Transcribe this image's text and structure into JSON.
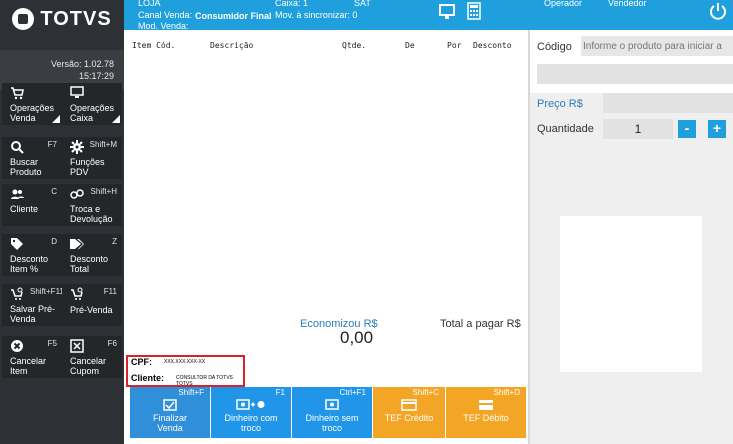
{
  "brand": {
    "name": "TOTVS"
  },
  "sidebar": {
    "version": "Versão: 1.02.78",
    "time": "15:17:29",
    "tiles": [
      {
        "label": "Operações Venda",
        "key": "",
        "icon": "cart-icon"
      },
      {
        "label": "Operações Caixa",
        "key": "",
        "icon": "monitor-icon"
      },
      {
        "label": "Buscar Produto",
        "key": "F7",
        "icon": "search-icon"
      },
      {
        "label": "Funções PDV",
        "key": "Shift+M",
        "icon": "gear-icon"
      },
      {
        "label": "Cliente",
        "key": "C",
        "icon": "users-icon"
      },
      {
        "label": "Troca e Devolução",
        "key": "Shift+H",
        "icon": "exchange-icon"
      },
      {
        "label": "Desconto Item %",
        "key": "D",
        "icon": "tag-icon"
      },
      {
        "label": "Desconto Total",
        "key": "Z",
        "icon": "tags-icon"
      },
      {
        "label": "Salvar Pré-Venda",
        "key": "Shift+F11",
        "icon": "cart-save-icon"
      },
      {
        "label": "Pré-Venda",
        "key": "F11",
        "icon": "cart-clock-icon"
      },
      {
        "label": "Cancelar Item",
        "key": "F5",
        "icon": "close-circle-icon"
      },
      {
        "label": "Cancelar Cupom",
        "key": "F6",
        "icon": "cancel-box-icon"
      }
    ]
  },
  "topbar": {
    "loja_label": "LOJA",
    "caixa": "Caixa: 1",
    "sat": "SAT",
    "canal_label": "Canal Venda:",
    "canal_value": "Consumidor Final",
    "mov": "Mov. à sincronizar: 0",
    "mod_label": "Mod. Venda:",
    "operador": "Operador",
    "vendedor": "Vendedor"
  },
  "table": {
    "headers": [
      "Item Cód.",
      "Descrição",
      "Qtde.",
      "De",
      "Por",
      "Desconto"
    ]
  },
  "totals": {
    "economizou_label": "Economizou R$",
    "economizou_value": "0,00",
    "total_label": "Total a pagar R$"
  },
  "customer": {
    "cpf_label": "CPF:",
    "cpf_value": "XXX.XXX.XXX-XX",
    "cliente_label": "Cliente:",
    "cliente_value": "CONSULTOR DA TOTVS TOTVS"
  },
  "actions": [
    {
      "key": "Shift+F",
      "label": "Finalizar Venda",
      "color": "#2f8fd8",
      "icon": "checkbox-icon"
    },
    {
      "key": "F1",
      "label": "Dinheiro com troco",
      "color": "#2196e9",
      "icon": "cash-change-icon"
    },
    {
      "key": "Ctrl+F1",
      "label": "Dinheiro sem troco",
      "color": "#2196e9",
      "icon": "cash-icon"
    },
    {
      "key": "Shift+C",
      "label": "TEF Crédito",
      "color": "#f3a626",
      "icon": "credit-card-icon"
    },
    {
      "key": "Shift+D",
      "label": "TEF Débito",
      "color": "#f3a626",
      "icon": "debit-card-icon"
    }
  ],
  "product": {
    "codigo_label": "Código",
    "codigo_placeholder": "Informe o produto para iniciar a",
    "preco_label": "Preço R$",
    "quantidade_label": "Quantidade",
    "quantidade_value": "1",
    "minus": "-",
    "plus": "+"
  }
}
